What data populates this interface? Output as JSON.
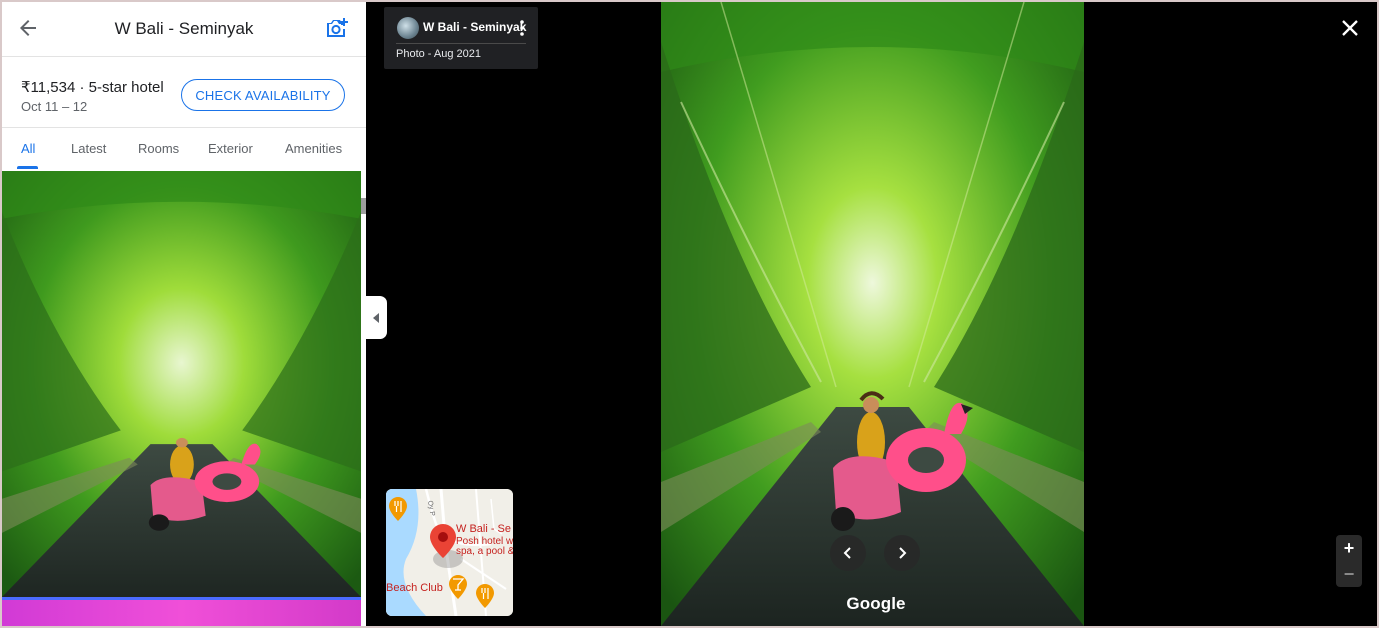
{
  "panel": {
    "title": "W Bali - Seminyak",
    "price_line": "₹11,534 · 5-star hotel",
    "dates": "Oct 11 – 12",
    "check_label": "CHECK AVAILABILITY",
    "tabs": [
      {
        "label": "All",
        "active": true
      },
      {
        "label": "Latest",
        "active": false
      },
      {
        "label": "Rooms",
        "active": false
      },
      {
        "label": "Exterior",
        "active": false
      },
      {
        "label": "Amenities",
        "active": false
      }
    ],
    "icons": [
      "back-arrow-icon",
      "add-photo-icon"
    ]
  },
  "viewer": {
    "contributor_name": "W Bali - Seminyak",
    "photo_meta": "Photo - Aug 2021",
    "watermark": "Google",
    "zoom_in": "+",
    "zoom_out": "−",
    "map": {
      "place_name": "W Bali - Se",
      "place_desc_1": "Posh hotel w",
      "place_desc_2": "spa, a pool &",
      "poi_label": "Beach Club"
    }
  },
  "colors": {
    "accent": "#1a73e8",
    "viewer_bg": "#000000",
    "card_bg": "#202124"
  }
}
